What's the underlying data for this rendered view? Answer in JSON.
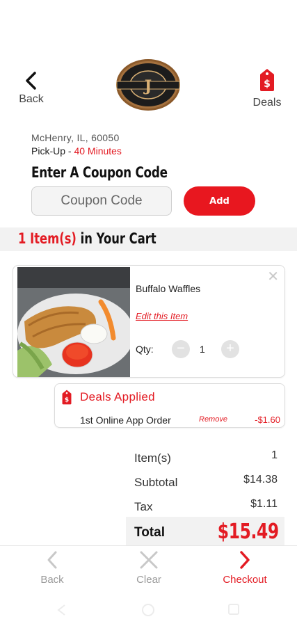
{
  "header": {
    "back_label": "Back",
    "deals_label": "Deals",
    "logo_letters": "J",
    "logo_text": "PICK • SWIRL • DIG • ORDER • GO"
  },
  "store": {
    "address": "McHenry, IL, 60050",
    "pickup_label": "Pick-Up - ",
    "pickup_time": "40 Minutes"
  },
  "coupon": {
    "title": "Enter A Coupon Code",
    "placeholder": "Coupon Code",
    "add_label": "Add"
  },
  "cart": {
    "count_label": "1 Item(s)",
    "suffix_label": " in Your Cart"
  },
  "item": {
    "name": "Buffalo Waffles",
    "edit_label": "Edit this Item",
    "qty_label": "Qty:",
    "qty_value": "1",
    "close_symbol": "✕",
    "minus_symbol": "−",
    "plus_symbol": "+"
  },
  "deals_applied": {
    "title": "Deals Applied",
    "deal_name": "1st Online App Order",
    "remove_label": "Remove",
    "amount": "-$1.60"
  },
  "summary": {
    "items_label": "Item(s)",
    "items_value": "1",
    "subtotal_label": "Subtotal",
    "subtotal_value": "$14.38",
    "tax_label": "Tax",
    "tax_value": "$1.11",
    "total_label": "Total",
    "total_value": "$15.49"
  },
  "bottom_nav": {
    "back_label": "Back",
    "clear_label": "Clear",
    "checkout_label": "Checkout"
  },
  "colors": {
    "accent": "#e31b23",
    "muted": "#9a9a9a"
  }
}
